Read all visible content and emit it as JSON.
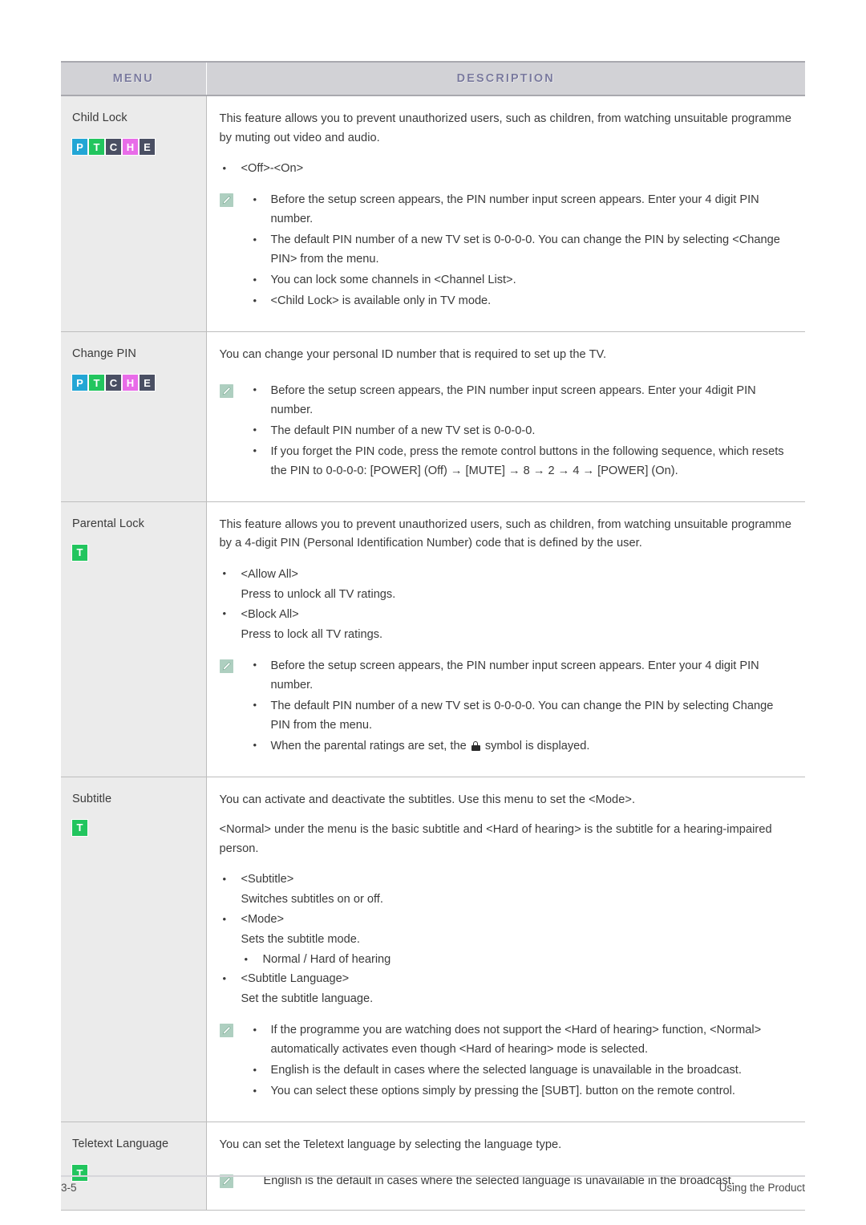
{
  "table": {
    "headers": {
      "menu": "MENU",
      "description": "DESCRIPTION"
    },
    "rows": [
      {
        "menu": "Child Lock",
        "badges": [
          {
            "letter": "P",
            "color": "#23a6d5"
          },
          {
            "letter": "T",
            "color": "#22c55e"
          },
          {
            "letter": "C",
            "color": "#4a4f63"
          },
          {
            "letter": "H",
            "color": "#e86ce8"
          },
          {
            "letter": "E",
            "color": "#4a4f63"
          }
        ],
        "intro": "This feature allows you to prevent unauthorized users, such as children, from watching unsuitable programme by muting out video and audio.",
        "options": [
          "<Off>-<On>"
        ],
        "note_items": [
          "Before the setup screen appears, the PIN number input screen appears. Enter your 4 digit PIN number.",
          "The default PIN number of a new TV set is 0-0-0-0. You can change the PIN by selecting <Change PIN> from the menu.",
          "You can lock some channels in <Channel List>.",
          "<Child Lock> is available only in TV mode."
        ]
      },
      {
        "menu": "Change PIN",
        "badges": [
          {
            "letter": "P",
            "color": "#23a6d5"
          },
          {
            "letter": "T",
            "color": "#22c55e"
          },
          {
            "letter": "C",
            "color": "#4a4f63"
          },
          {
            "letter": "H",
            "color": "#e86ce8"
          },
          {
            "letter": "E",
            "color": "#4a4f63"
          }
        ],
        "intro": "You can change your personal ID number that is required to set up the TV.",
        "note_items": [
          "Before the setup screen appears, the PIN number input screen appears. Enter your 4digit PIN number.",
          "The default PIN number of a new TV set is 0-0-0-0.",
          "If you forget the PIN code, press the remote control buttons in the following sequence, which resets the PIN to 0-0-0-0: [POWER] (Off) → [MUTE] → 8 → 2 → 4 → [POWER] (On)."
        ]
      },
      {
        "menu": "Parental Lock",
        "badges": [
          {
            "letter": "T",
            "color": "#22c55e"
          }
        ],
        "intro": "This feature allows you to prevent unauthorized users, such as children, from watching unsuitable programme by a 4-digit PIN (Personal Identification Number) code that is defined by the user.",
        "option_pairs": [
          {
            "label": "<Allow All>",
            "detail": "Press to unlock all TV ratings."
          },
          {
            "label": "<Block All>",
            "detail": "Press to lock all TV ratings."
          }
        ],
        "note_items": [
          "Before the setup screen appears, the PIN number input screen appears. Enter your 4 digit PIN number.",
          "The default PIN number of a new TV set is 0-0-0-0. You can change the PIN by selecting Change PIN from the menu."
        ],
        "note_lock_item": {
          "before": "When the parental ratings are set, the",
          "after": "symbol is displayed."
        }
      },
      {
        "menu": "Subtitle",
        "badges": [
          {
            "letter": "T",
            "color": "#22c55e"
          }
        ],
        "intro": "You can activate and deactivate the subtitles. Use this menu to set the <Mode>.",
        "intro2": "<Normal> under the menu is the basic subtitle and <Hard of hearing> is the subtitle for a hearing-impaired person.",
        "option_pairs": [
          {
            "label": "<Subtitle>",
            "detail": "Switches subtitles on or off."
          },
          {
            "label": "<Mode>",
            "detail": "Sets the subtitle mode.",
            "sub": [
              "Normal / Hard of hearing"
            ]
          },
          {
            "label": "<Subtitle Language>",
            "detail": "Set the subtitle language."
          }
        ],
        "note_items": [
          "If the programme you are watching does not support the <Hard of hearing> function, <Normal> automatically activates even though <Hard of hearing> mode is selected.",
          "English is the default in cases where the selected language is unavailable in the broadcast.",
          "You can select these options simply by pressing the [SUBT]. button on the remote control."
        ]
      },
      {
        "menu": "Teletext Language",
        "badges": [
          {
            "letter": "T",
            "color": "#22c55e"
          }
        ],
        "intro": "You can set the Teletext language by selecting the language type.",
        "note_plain": "English is the default in cases where the selected language is unavailable in the broadcast."
      }
    ]
  },
  "footer": {
    "page_number": "3-5",
    "section": "Using the Product"
  },
  "icons": {
    "note": "note-pencil-icon",
    "lock": "padlock-icon"
  }
}
